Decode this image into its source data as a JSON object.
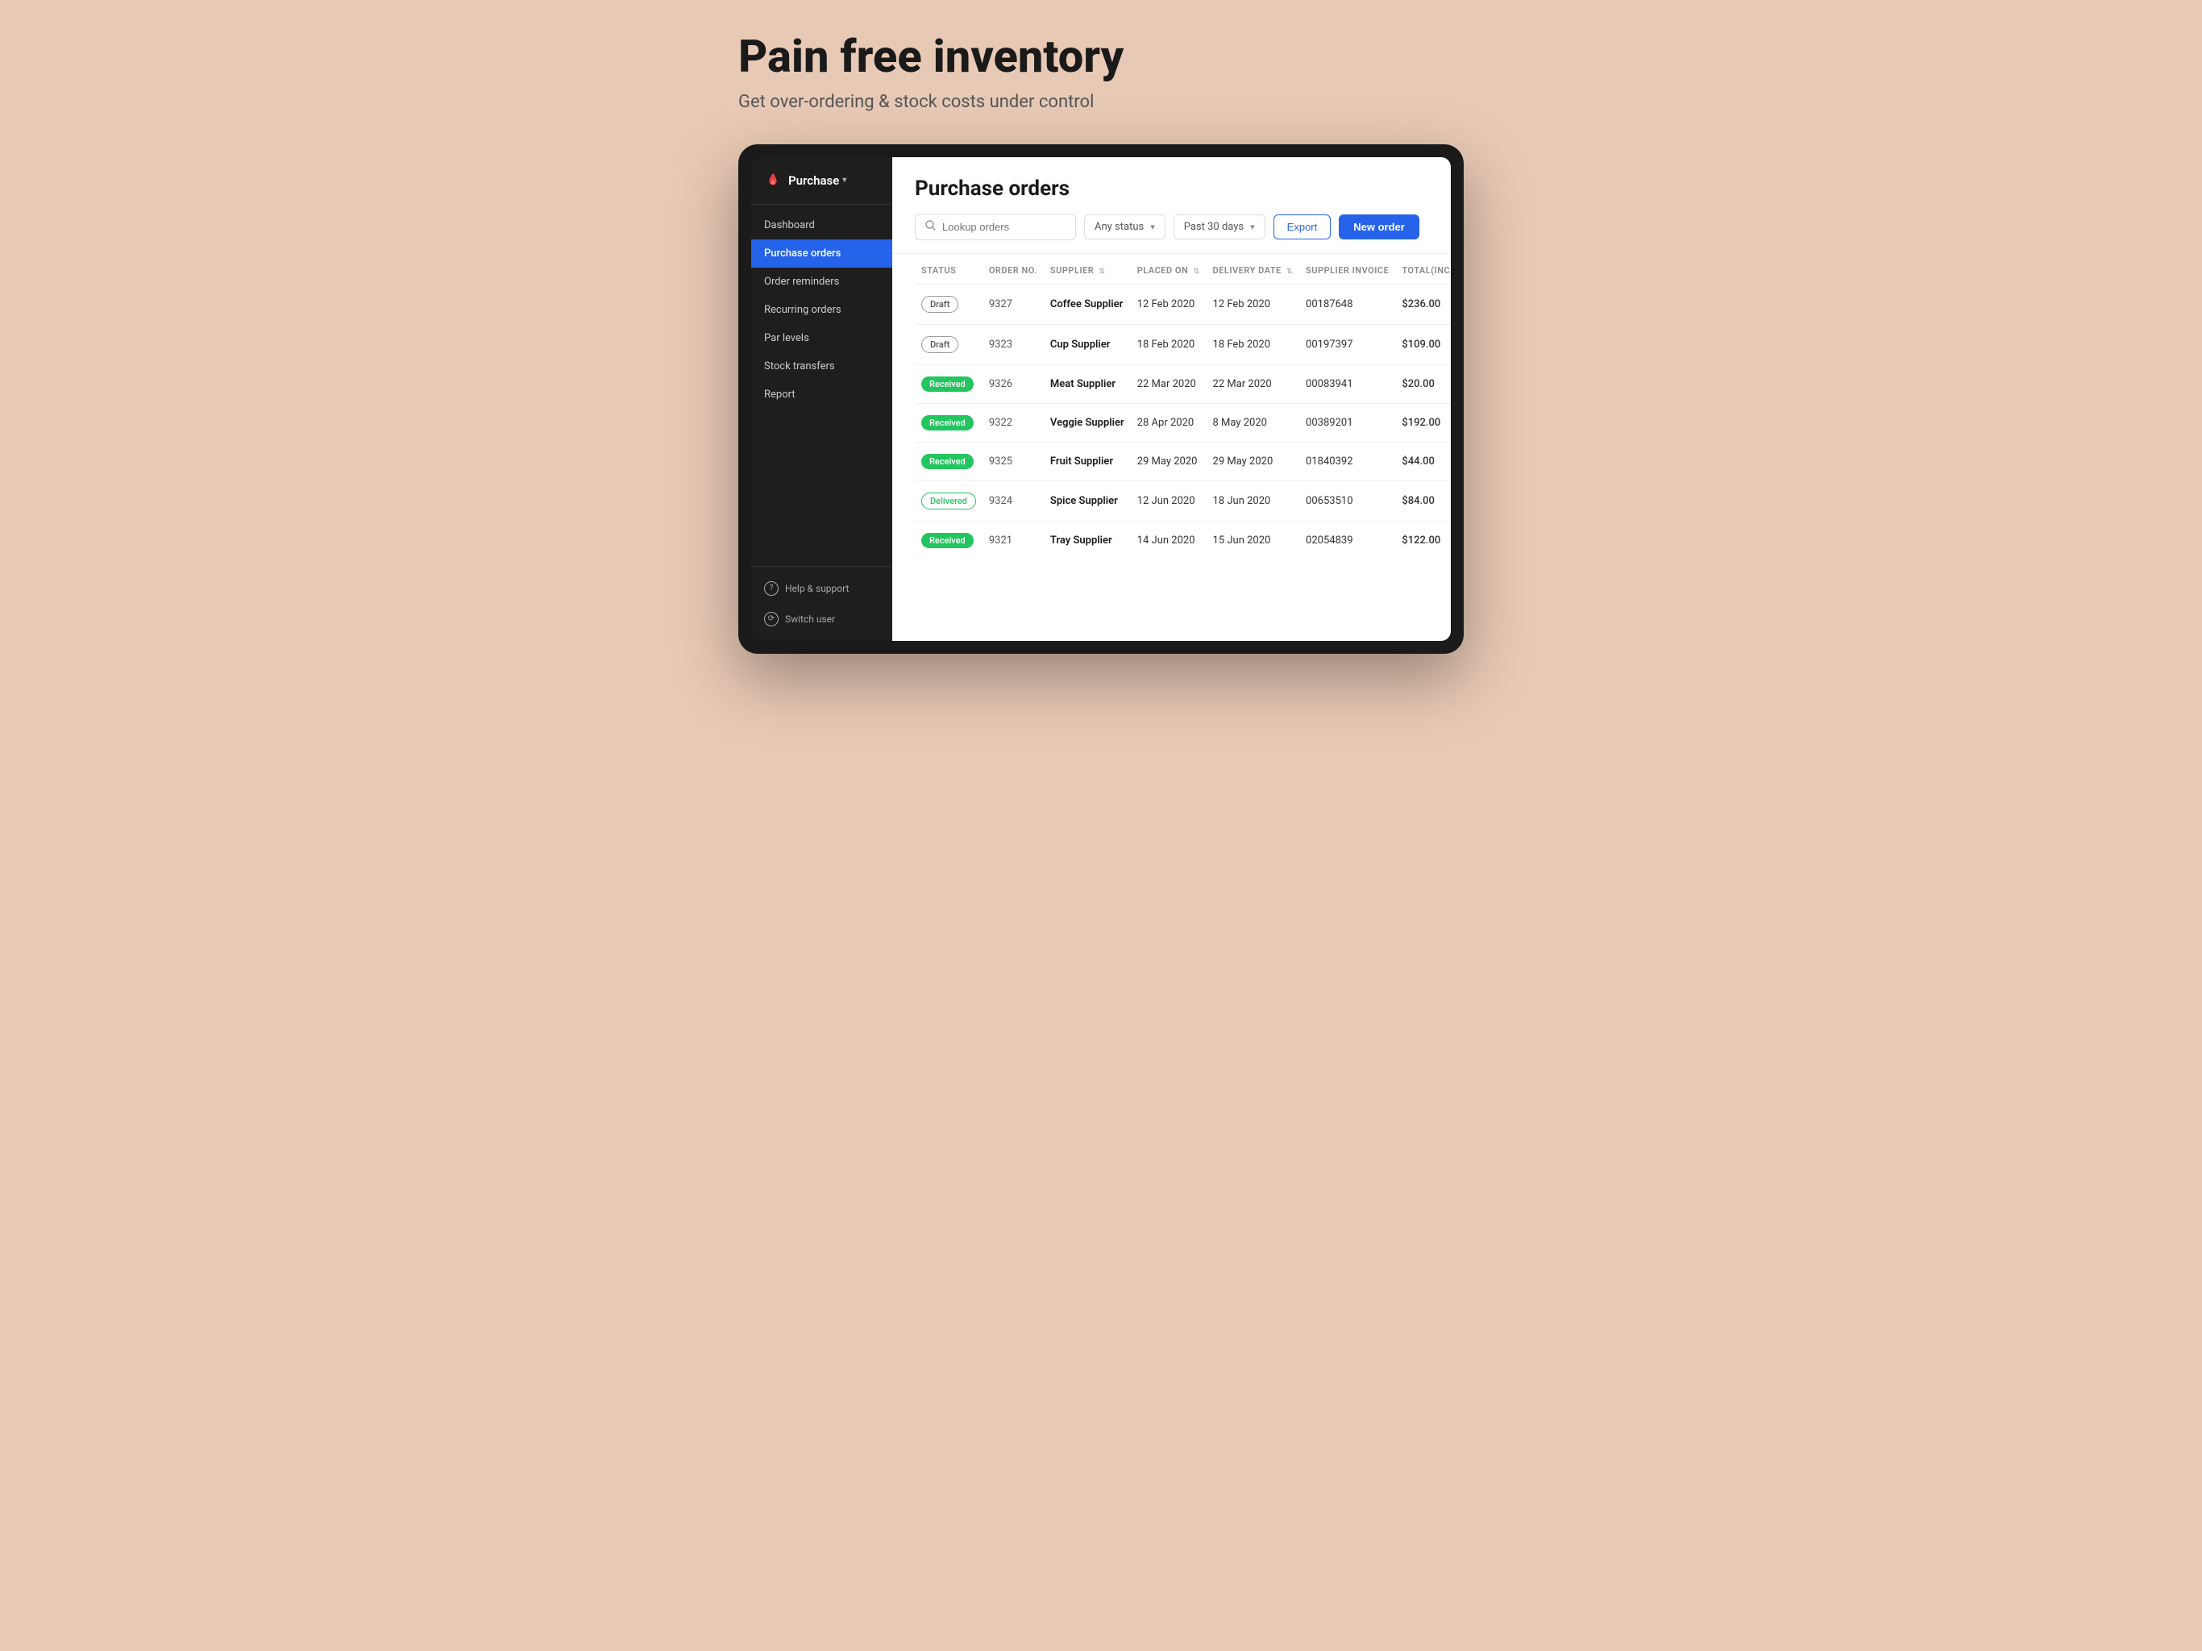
{
  "hero": {
    "title": "Pain free inventory",
    "subtitle": "Get over-ordering & stock costs under control"
  },
  "sidebar": {
    "brand": "Purchase",
    "brand_chevron": "▾",
    "nav_items": [
      {
        "id": "dashboard",
        "label": "Dashboard",
        "active": false
      },
      {
        "id": "purchase-orders",
        "label": "Purchase orders",
        "active": true
      },
      {
        "id": "order-reminders",
        "label": "Order reminders",
        "active": false
      },
      {
        "id": "recurring-orders",
        "label": "Recurring orders",
        "active": false
      },
      {
        "id": "par-levels",
        "label": "Par levels",
        "active": false
      },
      {
        "id": "stock-transfers",
        "label": "Stock transfers",
        "active": false
      },
      {
        "id": "report",
        "label": "Report",
        "active": false
      }
    ],
    "footer_items": [
      {
        "id": "help-support",
        "label": "Help & support",
        "icon": "?"
      },
      {
        "id": "switch-user",
        "label": "Switch user",
        "icon": "⟳"
      }
    ]
  },
  "main": {
    "page_title": "Purchase orders",
    "toolbar": {
      "search_placeholder": "Lookup orders",
      "status_filter": "Any status",
      "date_filter": "Past 30 days",
      "export_label": "Export",
      "new_order_label": "New order"
    },
    "table": {
      "columns": [
        "STATUS",
        "ORDER NO.",
        "SUPPLIER",
        "PLACED ON",
        "DELIVERY DATE",
        "SUPPLIER INVOICE",
        "TOTAL(INC.)"
      ],
      "rows": [
        {
          "status": "Draft",
          "status_type": "draft",
          "order_no": "9327",
          "supplier": "Coffee Supplier",
          "placed_on": "12 Feb 2020",
          "delivery_date": "12 Feb 2020",
          "invoice": "00187648",
          "total": "$236.00"
        },
        {
          "status": "Draft",
          "status_type": "draft",
          "order_no": "9323",
          "supplier": "Cup Supplier",
          "placed_on": "18 Feb 2020",
          "delivery_date": "18 Feb 2020",
          "invoice": "00197397",
          "total": "$109.00"
        },
        {
          "status": "Received",
          "status_type": "received",
          "order_no": "9326",
          "supplier": "Meat Supplier",
          "placed_on": "22 Mar 2020",
          "delivery_date": "22 Mar 2020",
          "invoice": "00083941",
          "total": "$20.00"
        },
        {
          "status": "Received",
          "status_type": "received",
          "order_no": "9322",
          "supplier": "Veggie Supplier",
          "placed_on": "28 Apr 2020",
          "delivery_date": "8 May 2020",
          "invoice": "00389201",
          "total": "$192.00"
        },
        {
          "status": "Received",
          "status_type": "received",
          "order_no": "9325",
          "supplier": "Fruit Supplier",
          "placed_on": "29 May 2020",
          "delivery_date": "29 May 2020",
          "invoice": "01840392",
          "total": "$44.00"
        },
        {
          "status": "Delivered",
          "status_type": "delivered",
          "order_no": "9324",
          "supplier": "Spice Supplier",
          "placed_on": "12 Jun 2020",
          "delivery_date": "18 Jun 2020",
          "invoice": "00653510",
          "total": "$84.00"
        },
        {
          "status": "Received",
          "status_type": "received",
          "order_no": "9321",
          "supplier": "Tray Supplier",
          "placed_on": "14 Jun 2020",
          "delivery_date": "15 Jun 2020",
          "invoice": "02054839",
          "total": "$122.00"
        }
      ]
    }
  },
  "colors": {
    "sidebar_bg": "#1e1e1e",
    "active_nav": "#2563eb",
    "received_badge": "#22c55e",
    "accent_blue": "#2563eb"
  }
}
